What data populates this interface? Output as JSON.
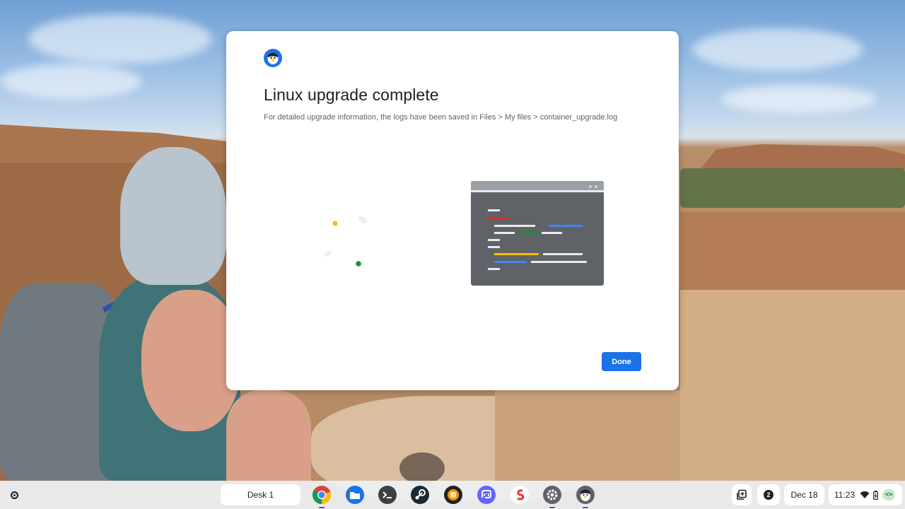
{
  "dialog": {
    "app_icon": "linux-penguin-icon",
    "title": "Linux upgrade complete",
    "message": "For detailed upgrade information, the logs have been saved in Files > My files > container_upgrade.log",
    "done_label": "Done"
  },
  "shelf": {
    "launcher_icon": "launcher-circle-icon",
    "desk_label": "Desk 1",
    "apps": [
      {
        "name": "chrome",
        "icon": "chrome-icon",
        "running": true
      },
      {
        "name": "files",
        "icon": "files-folder-icon",
        "running": false
      },
      {
        "name": "terminal",
        "icon": "terminal-icon",
        "running": false
      },
      {
        "name": "steam",
        "icon": "steam-icon",
        "running": false
      },
      {
        "name": "app-5",
        "icon": "app-5-icon",
        "running": false
      },
      {
        "name": "mastodon",
        "icon": "mastodon-icon",
        "running": false
      },
      {
        "name": "app-7",
        "icon": "app-7-icon",
        "running": false
      },
      {
        "name": "settings",
        "icon": "settings-gear-icon",
        "running": true
      },
      {
        "name": "linux",
        "icon": "linux-penguin-icon",
        "running": true
      }
    ],
    "tray": {
      "holding_space_icon": "holding-space-icon",
      "notification_count": "2",
      "date": "Dec 18",
      "time": "11:23",
      "status_icons": [
        "wifi-icon",
        "battery-icon",
        "code-icon"
      ]
    }
  },
  "colors": {
    "accent": "#1a73e8",
    "dialog_bg": "#ffffff",
    "title_text": "#202124",
    "secondary_text": "#5f6368",
    "illustration_window": "#5f6368",
    "google_red": "#d93025",
    "google_blue": "#4285f4",
    "google_green": "#1e8e3e",
    "google_yellow": "#fbbc04"
  }
}
